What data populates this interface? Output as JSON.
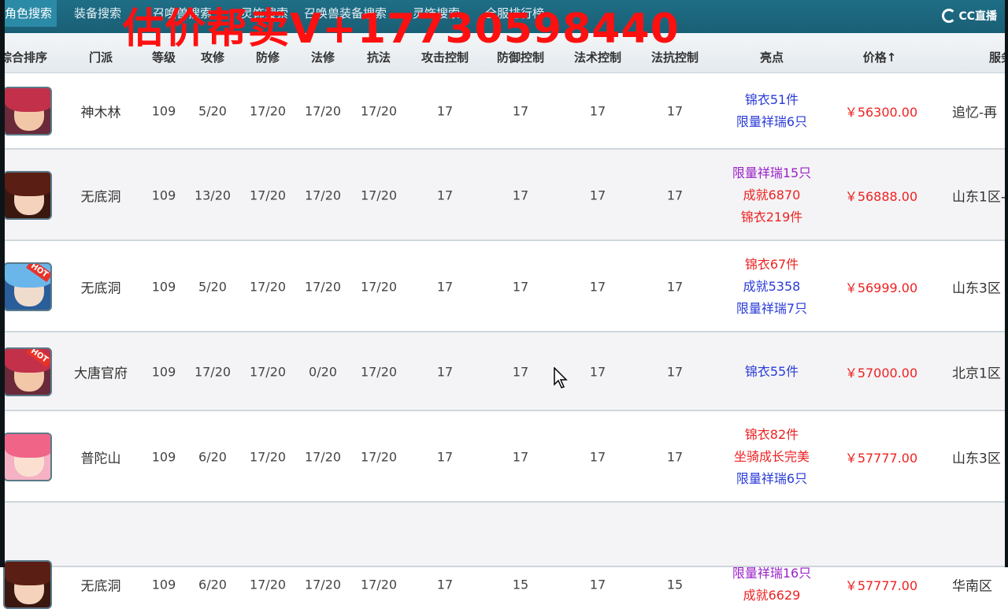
{
  "tabs": [
    {
      "label": "角色搜索",
      "active": true
    },
    {
      "label": "装备搜索",
      "active": false
    },
    {
      "label": "召唤兽搜索",
      "active": false
    },
    {
      "label": "灵饰搜索",
      "active": false
    },
    {
      "label": "召唤兽装备搜索",
      "active": false
    },
    {
      "label": "灵饰搜索",
      "active": false
    },
    {
      "label": "全服排行榜",
      "active": false
    }
  ],
  "watermark": "估价帮卖V+17730598440",
  "logo": {
    "text": "CC直播",
    "icon": "cc-live-logo"
  },
  "columns": [
    {
      "label": "综合排序"
    },
    {
      "label": "门派"
    },
    {
      "label": "等级"
    },
    {
      "label": "攻修"
    },
    {
      "label": "防修"
    },
    {
      "label": "法修"
    },
    {
      "label": "抗法"
    },
    {
      "label": "攻击控制"
    },
    {
      "label": "防御控制"
    },
    {
      "label": "法术控制"
    },
    {
      "label": "法抗控制"
    },
    {
      "label": "亮点"
    },
    {
      "label": "价格↑"
    },
    {
      "label": "服务器"
    }
  ],
  "rows": [
    {
      "avatar": "red-hair-swordsman-avatar",
      "hot": false,
      "school": "神木林",
      "level": "109",
      "atk": "5/20",
      "def": "17/20",
      "mag": "17/20",
      "res": "17/20",
      "atk_ctrl": "17",
      "def_ctrl": "17",
      "mag_ctrl": "17",
      "res_ctrl": "17",
      "highlights": [
        {
          "text": "锦衣51件",
          "color": "blue"
        },
        {
          "text": "限量祥瑞6只",
          "color": "blue"
        }
      ],
      "price": "￥56300.00",
      "server": "追忆-再"
    },
    {
      "avatar": "brown-hair-girl-avatar",
      "hot": false,
      "school": "无底洞",
      "level": "109",
      "atk": "13/20",
      "def": "17/20",
      "mag": "17/20",
      "res": "17/20",
      "atk_ctrl": "17",
      "def_ctrl": "17",
      "mag_ctrl": "17",
      "res_ctrl": "17",
      "highlights": [
        {
          "text": "限量祥瑞15只",
          "color": "purple"
        },
        {
          "text": "成就6870",
          "color": "red"
        },
        {
          "text": "锦衣219件",
          "color": "red"
        }
      ],
      "price": "￥56888.00",
      "server": "山东1区-"
    },
    {
      "avatar": "blue-hair-hero-avatar",
      "hot": true,
      "school": "无底洞",
      "level": "109",
      "atk": "5/20",
      "def": "17/20",
      "mag": "17/20",
      "res": "17/20",
      "atk_ctrl": "17",
      "def_ctrl": "17",
      "mag_ctrl": "17",
      "res_ctrl": "17",
      "highlights": [
        {
          "text": "锦衣67件",
          "color": "red"
        },
        {
          "text": "成就5358",
          "color": "blue"
        },
        {
          "text": "限量祥瑞7只",
          "color": "blue"
        }
      ],
      "price": "￥56999.00",
      "server": "山东3区"
    },
    {
      "avatar": "red-hair-swordsman-avatar",
      "hot": true,
      "school": "大唐官府",
      "level": "109",
      "atk": "17/20",
      "def": "17/20",
      "mag": "0/20",
      "res": "17/20",
      "atk_ctrl": "17",
      "def_ctrl": "17",
      "mag_ctrl": "17",
      "res_ctrl": "17",
      "highlights": [
        {
          "text": "锦衣55件",
          "color": "blue"
        }
      ],
      "price": "￥57000.00",
      "server": "北京1区"
    },
    {
      "avatar": "pink-hair-girl-avatar",
      "hot": false,
      "school": "普陀山",
      "level": "109",
      "atk": "6/20",
      "def": "17/20",
      "mag": "17/20",
      "res": "17/20",
      "atk_ctrl": "17",
      "def_ctrl": "17",
      "mag_ctrl": "17",
      "res_ctrl": "17",
      "highlights": [
        {
          "text": "锦衣82件",
          "color": "red"
        },
        {
          "text": "坐骑成长完美",
          "color": "red"
        },
        {
          "text": "限量祥瑞6只",
          "color": "blue"
        }
      ],
      "price": "￥57777.00",
      "server": "山东3区"
    },
    {
      "avatar": "brown-hair-girl-avatar",
      "hot": false,
      "school": "无底洞",
      "level": "109",
      "atk": "6/20",
      "def": "17/20",
      "mag": "17/20",
      "res": "17/20",
      "atk_ctrl": "17",
      "def_ctrl": "15",
      "mag_ctrl": "17",
      "res_ctrl": "15",
      "highlights": [
        {
          "text": "限量祥瑞16只",
          "color": "purple"
        },
        {
          "text": "成就6629",
          "color": "red"
        }
      ],
      "price": "￥57777.00",
      "server": "华南区"
    }
  ],
  "colors": {
    "accent": "#1e6e86",
    "price": "#ee2222",
    "blue": "#2a3bd6",
    "red": "#ee2222",
    "purple": "#9b22c8"
  }
}
